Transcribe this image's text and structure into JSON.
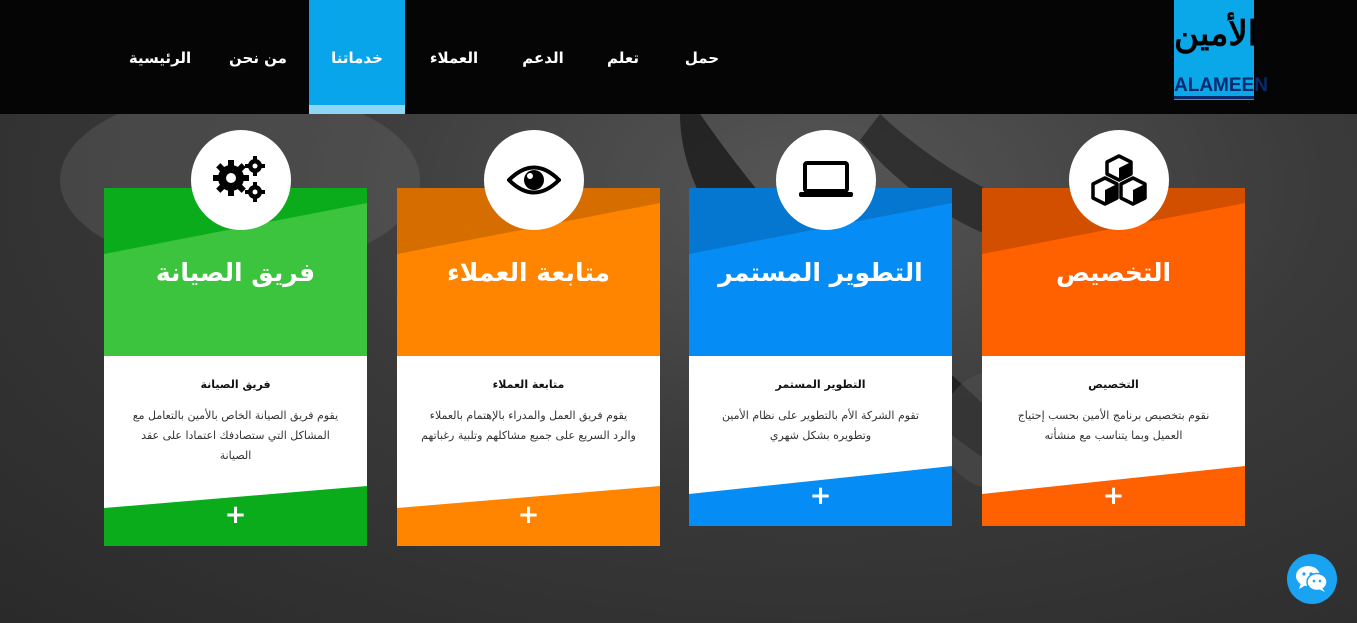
{
  "logo": {
    "arabic": "الأمين",
    "latin": "ALAMEEN"
  },
  "nav": {
    "items": [
      {
        "label": "حمل"
      },
      {
        "label": "تعلم"
      },
      {
        "label": "الدعم"
      },
      {
        "label": "العملاء"
      },
      {
        "label": "خدماتنا",
        "active": true
      },
      {
        "label": "من نحن"
      },
      {
        "label": "الرئيسية"
      }
    ]
  },
  "cards": [
    {
      "title": "فريق الصيانة",
      "subtitle": "فريق الصيانة",
      "description": "يقوم فريق الصيانة الخاص بالأمين بالتعامل مع المشاكل التي ستصادفك اعتمادا على عقد الصيانة",
      "plus": "+",
      "icon": "gears-icon",
      "color": "#0aac1b"
    },
    {
      "title": "متابعة العملاء",
      "subtitle": "متابعة العملاء",
      "description": "يقوم فريق العمل والمدراء بالإهتمام بالعملاء والرد السريع على جميع مشاكلهم وتلبية رغباتهم",
      "plus": "+",
      "icon": "eye-icon",
      "color": "#ff8400"
    },
    {
      "title": "التطوير المستمر",
      "subtitle": "التطوير المستمر",
      "description": "تقوم الشركة الأم بالتطوير على نظام الأمين وتطويره بشكل شهري",
      "plus": "+",
      "icon": "laptop-icon",
      "color": "#068df5"
    },
    {
      "title": "التخصيص",
      "subtitle": "التخصيص",
      "description": "نقوم بتخصيص برنامج الأمين بحسب إحتياج العميل وبما يتناسب مع منشأته",
      "plus": "+",
      "icon": "cubes-icon",
      "color": "#ff6000"
    }
  ],
  "chat": {
    "icon": "wechat-icon",
    "color": "#1aa3f0"
  }
}
